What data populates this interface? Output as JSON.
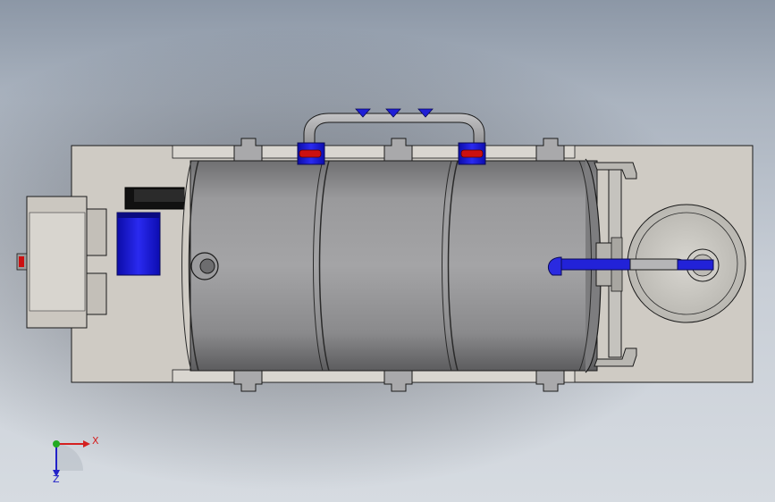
{
  "scene": {
    "model_colors": {
      "background_top": "#8c97a6",
      "background_bottom": "#d6dbe1",
      "base_plate": "#cfcbc4",
      "tank_body": "#8f8f91",
      "steel_parts": "#a8a8aa",
      "blue_parts": "#1f1fd6",
      "red_parts": "#cc1010",
      "edges": "#1a1a1a"
    }
  },
  "triad": {
    "x_label": "X",
    "z_label": "Z",
    "x_color": "#d42020",
    "y_color": "#22aa22",
    "z_color": "#2222c8"
  }
}
